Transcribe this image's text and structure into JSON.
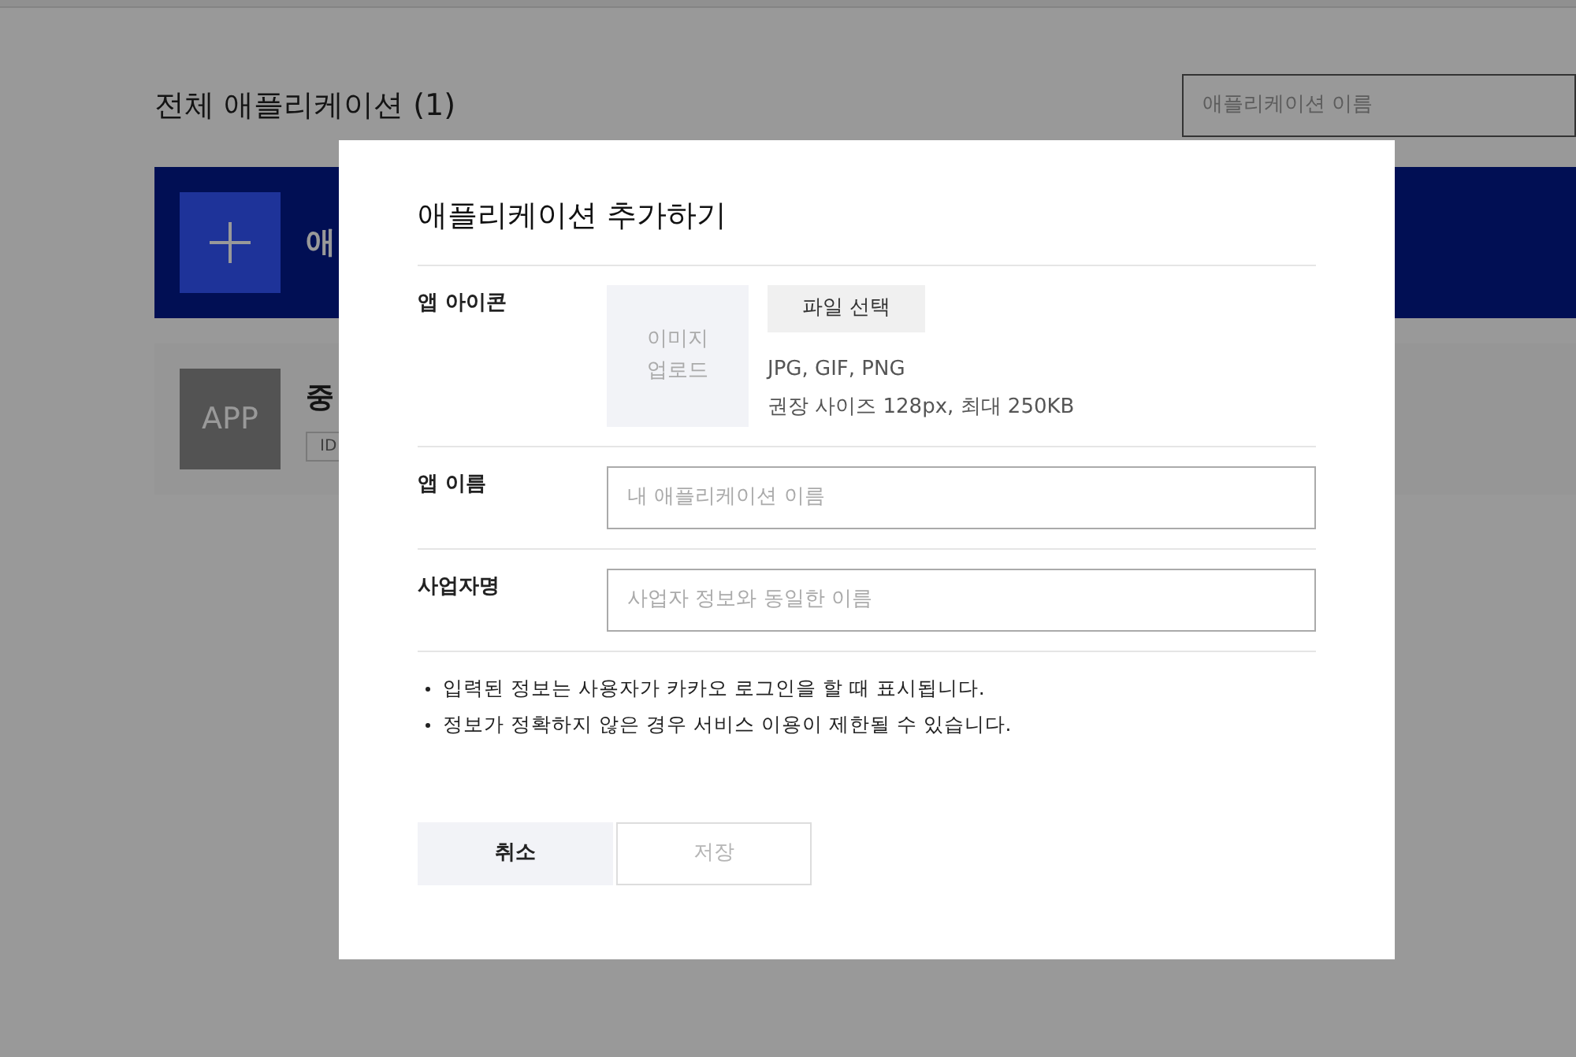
{
  "page": {
    "title": "전체 애플리케이션 (1)",
    "search": {
      "placeholder": "애플리케이션 이름"
    },
    "add_banner": {
      "label": "애"
    },
    "apps": [
      {
        "icon_text": "APP",
        "name": "중",
        "badge": "ID"
      }
    ]
  },
  "dialog": {
    "title": "애플리케이션 추가하기",
    "rows": [
      {
        "kind": "icon",
        "label": "앱 아이콘",
        "upload_lines": [
          "이미지",
          "업로드"
        ],
        "button": "파일 선택",
        "hints": [
          "JPG, GIF, PNG",
          "권장 사이즈 128px, 최대 250KB"
        ]
      },
      {
        "kind": "input",
        "label": "앱 이름",
        "placeholder": "내 애플리케이션 이름"
      },
      {
        "kind": "input",
        "label": "사업자명",
        "placeholder": "사업자 정보와 동일한 이름"
      }
    ],
    "notes": [
      "입력된 정보는 사용자가 카카오 로그인을 할 때 표시됩니다.",
      "정보가 정확하지 않은 경우 서비스 이용이 제한될 수 있습니다."
    ],
    "buttons": [
      {
        "label": "취소",
        "disabled": false
      },
      {
        "label": "저장",
        "disabled": true
      }
    ]
  }
}
